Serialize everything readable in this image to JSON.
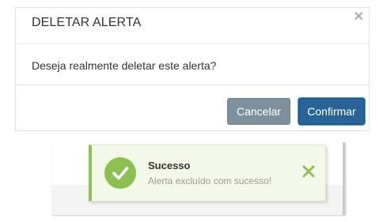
{
  "modal": {
    "title": "DELETAR ALERTA",
    "close_icon": "close-x-icon",
    "message": "Deseja realmente deletar este alerta?",
    "cancel_label": "Cancelar",
    "confirm_label": "Confirmar"
  },
  "toast": {
    "status": "success",
    "icon": "check-circle-icon",
    "title": "Sucesso",
    "message": "Alerta excluído com sucesso!",
    "close_icon": "close-x-icon"
  },
  "colors": {
    "cancel": "#7d919d",
    "confirm": "#2a6496",
    "success": "#8cc152",
    "toast_bg": "#f2f9e9"
  }
}
